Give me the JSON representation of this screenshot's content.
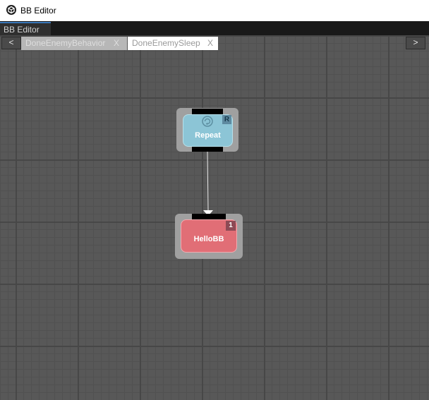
{
  "window": {
    "title": "BB Editor",
    "icon": "unity-icon"
  },
  "editor_tab": {
    "label": "BB Editor"
  },
  "file_tabs": {
    "prev_label": "<",
    "next_label": ">",
    "tabs": [
      {
        "label": "DoneEnemyBehavior",
        "close": "X",
        "active": false
      },
      {
        "label": "DoneEnemySleep",
        "close": "X",
        "active": true
      }
    ]
  },
  "graph": {
    "nodes": [
      {
        "label": "Repeat",
        "badge": "R",
        "icon": "repeat-icon",
        "color": "#8cc5d6"
      },
      {
        "label": "HelloBB",
        "badge": "1",
        "color": "#e16e76"
      }
    ]
  }
}
